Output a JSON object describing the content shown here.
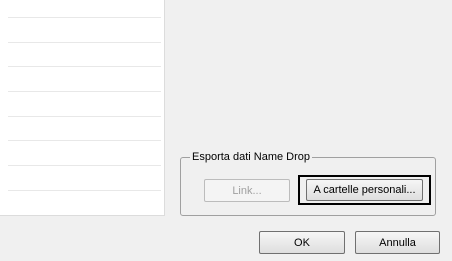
{
  "export_group": {
    "title": "Esporta dati Name Drop",
    "link_button": "Link...",
    "personal_folders_button": "A cartelle personali..."
  },
  "dialog_buttons": {
    "ok": "OK",
    "cancel": "Annulla"
  }
}
